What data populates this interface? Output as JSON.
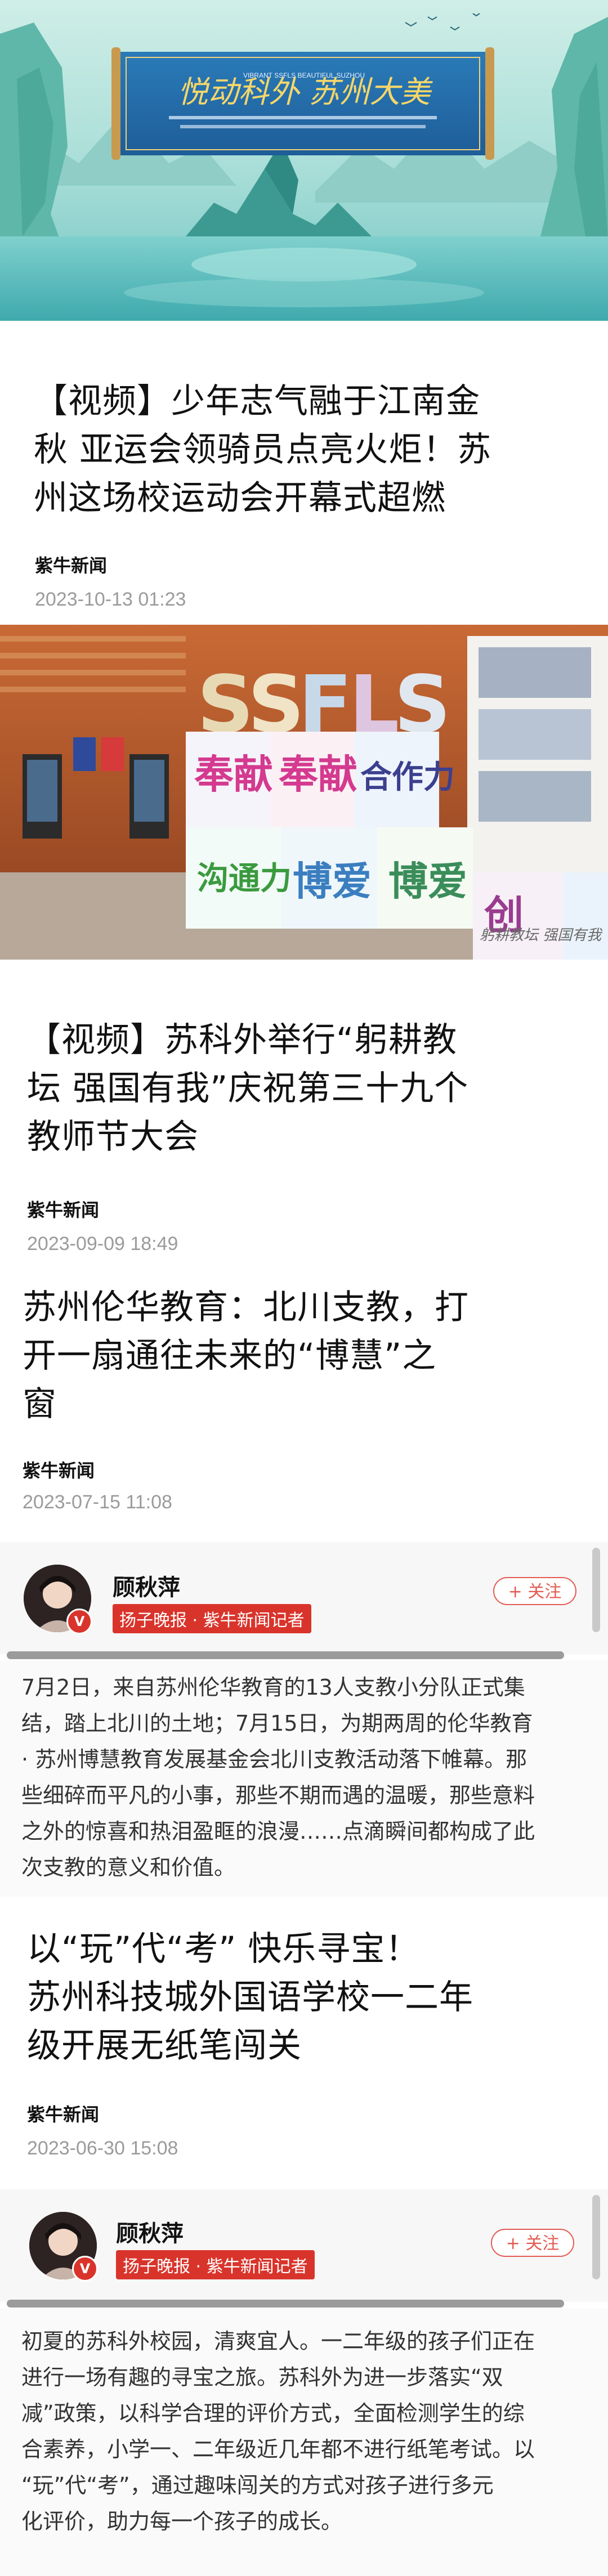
{
  "hero1": {
    "banner_title": "悦动科外 苏州大美",
    "banner_subtitle": "VIBRANT SSFLS BEAUTIFUL SUZHOU"
  },
  "article1": {
    "title_lines": [
      "【视频】少年志气融于江南金",
      "秋 亚运会领骑员点亮火炬！苏",
      "州这场校运动会开幕式超燃"
    ],
    "source": "紫牛新闻",
    "date": "2023-10-13 01:23"
  },
  "hero2": {
    "letters": [
      "S",
      "S",
      "F",
      "L",
      "S"
    ],
    "cube_words": [
      "奉献",
      "奉献",
      "合作力",
      "沟通力",
      "博爱",
      "博爱",
      "创"
    ],
    "corner_text": "躬耕教坛 强国有我"
  },
  "article2": {
    "title_lines": [
      "【视频】苏科外举行“躬耕教",
      "坛 强国有我”庆祝第三十九个",
      "教师节大会"
    ],
    "source": "紫牛新闻",
    "date": "2023-09-09 18:49"
  },
  "article3": {
    "title_lines": [
      "苏州伦华教育：北川支教，打",
      "开一扇通往未来的“博慧”之",
      "窗"
    ],
    "source": "紫牛新闻",
    "date": "2023-07-15 11:08"
  },
  "author1": {
    "name": "顾秋萍",
    "tag": "扬子晚报 · 紫牛新闻记者",
    "follow_label": "+ 关注",
    "badge": "V"
  },
  "summary1": {
    "lines": [
      "7月2日，来自苏州伦华教育的13人支教小分队正式集",
      "结，踏上北川的土地；7月15日，为期两周的伦华教育",
      "· 苏州博慧教育发展基金会北川支教活动落下帷幕。那",
      "些细碎而平凡的小事，那些不期而遇的温暖，那些意料",
      "之外的惊喜和热泪盈眶的浪漫……点滴瞬间都构成了此",
      "次支教的意义和价值。"
    ]
  },
  "article4": {
    "title_lines": [
      "以“玩”代“考” 快乐寻宝！",
      "苏州科技城外国语学校一二年",
      "级开展无纸笔闯关"
    ],
    "source": "紫牛新闻",
    "date": "2023-06-30 15:08"
  },
  "author2": {
    "name": "顾秋萍",
    "tag": "扬子晚报 · 紫牛新闻记者",
    "follow_label": "+ 关注",
    "badge": "V"
  },
  "summary2": {
    "lines": [
      "初夏的苏科外校园，清爽宜人。一二年级的孩子们正在",
      "进行一场有趣的寻宝之旅。苏科外为进一步落实“双",
      "减”政策，以科学合理的评价方式，全面检测学生的综",
      "合素养，小学一、二年级近几年都不进行纸笔考试。以",
      "“玩”代“考”，通过趣味闯关的方式对孩子进行多元",
      "化评价，助力每一个孩子的成长。"
    ]
  }
}
